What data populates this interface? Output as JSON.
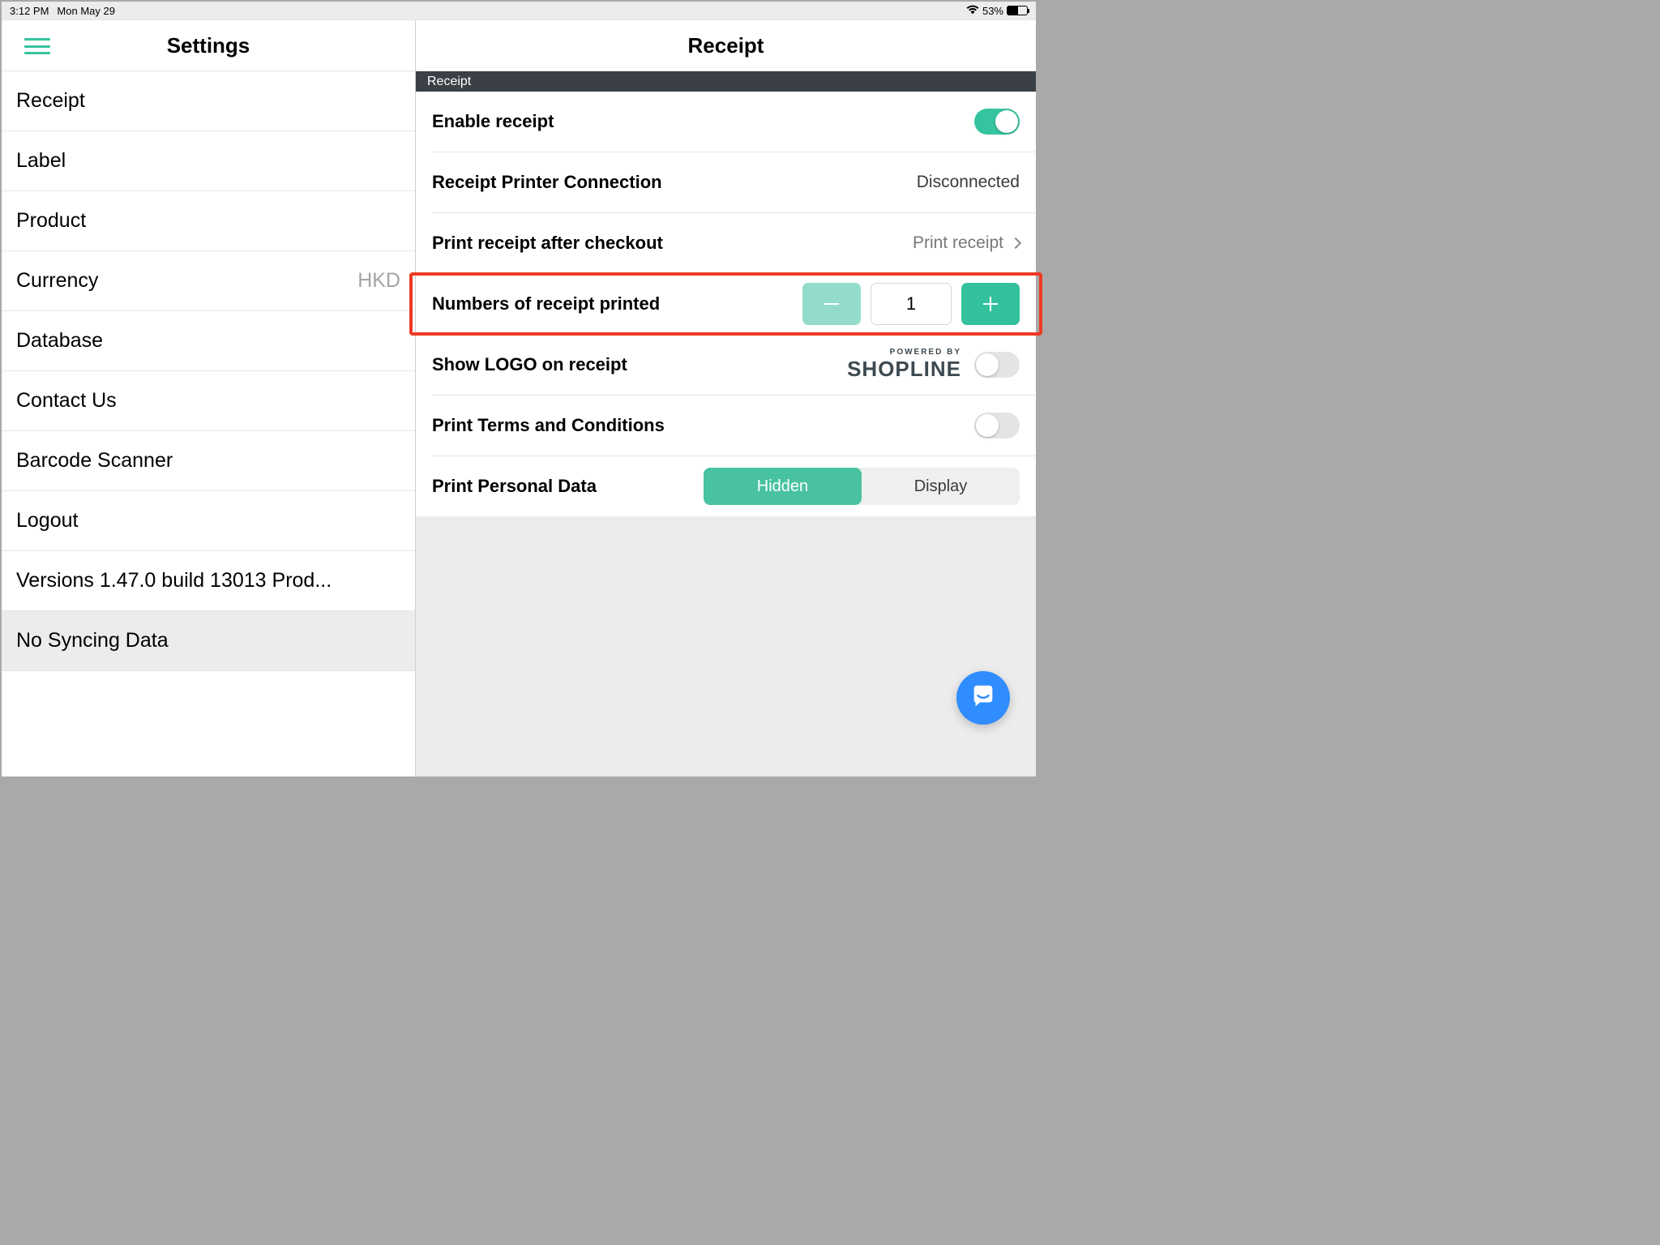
{
  "status": {
    "time": "3:12 PM",
    "date": "Mon May 29",
    "battery": "53%"
  },
  "left": {
    "title": "Settings",
    "items": [
      {
        "label": "Receipt"
      },
      {
        "label": "Label"
      },
      {
        "label": "Product"
      },
      {
        "label": "Currency",
        "value": "HKD"
      },
      {
        "label": "Database"
      },
      {
        "label": "Contact Us"
      },
      {
        "label": "Barcode Scanner"
      },
      {
        "label": "Logout"
      },
      {
        "label": "Versions 1.47.0   build 13013    Prod..."
      },
      {
        "label": "No Syncing Data"
      }
    ]
  },
  "right": {
    "title": "Receipt",
    "section": "Receipt",
    "rows": {
      "enable": "Enable receipt",
      "printerConn": {
        "label": "Receipt Printer Connection",
        "value": "Disconnected"
      },
      "afterCheckout": {
        "label": "Print receipt after checkout",
        "value": "Print receipt"
      },
      "numPrinted": {
        "label": "Numbers of receipt printed",
        "value": "1"
      },
      "showLogo": "Show LOGO on receipt",
      "poweredBy": "POWERED BY",
      "brand": "SHOPLINE",
      "terms": "Print Terms and Conditions",
      "personal": {
        "label": "Print Personal Data",
        "hidden": "Hidden",
        "display": "Display"
      }
    }
  }
}
